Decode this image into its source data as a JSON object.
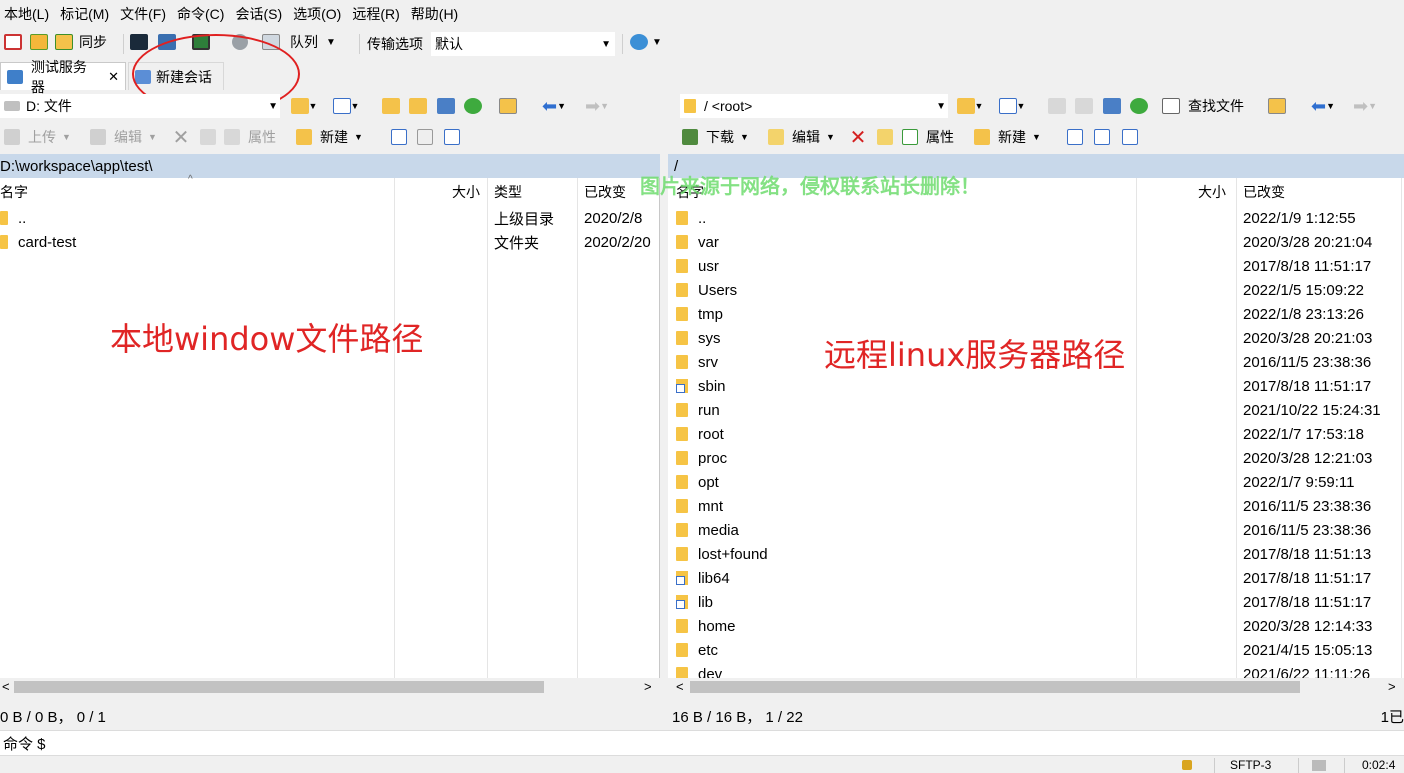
{
  "menu": [
    "本地(L)",
    "标记(M)",
    "文件(F)",
    "命令(C)",
    "会话(S)",
    "选项(O)",
    "远程(R)",
    "帮助(H)"
  ],
  "toolbar": {
    "sync_label": "同步",
    "queue_label": "队列",
    "transfer_options_label": "传输选项",
    "transfer_preset": "默认"
  },
  "tabs": {
    "active_label": "测试服务器",
    "close_glyph": "✕",
    "new_session_label": "新建会话"
  },
  "local": {
    "drive": "D: 文件",
    "upload_label": "上传",
    "edit_label": "编辑",
    "properties_label": "属性",
    "new_label": "新建",
    "path": "D:\\workspace\\app\\test\\",
    "columns": {
      "name": "名字",
      "size": "大小",
      "type": "类型",
      "modified": "已改变"
    },
    "rows": [
      {
        "name": "..",
        "size": "",
        "type": "上级目录",
        "modified": "2020/2/8"
      },
      {
        "name": "card-test",
        "size": "",
        "type": "文件夹",
        "modified": "2020/2/20"
      }
    ],
    "status": "0 B / 0 B， 0 / 1",
    "annotation": "本地window文件路径"
  },
  "remote": {
    "path_combo": "/ <root>",
    "find_files_label": "查找文件",
    "download_label": "下载",
    "edit_label": "编辑",
    "properties_label": "属性",
    "new_label": "新建",
    "path": "/",
    "columns": {
      "name": "名字",
      "size": "大小",
      "modified": "已改变"
    },
    "rows": [
      {
        "name": "..",
        "modified": "2022/1/9 1:12:55",
        "kind": "up"
      },
      {
        "name": "var",
        "modified": "2020/3/28 20:21:04",
        "kind": "folder"
      },
      {
        "name": "usr",
        "modified": "2017/8/18 11:51:17",
        "kind": "folder"
      },
      {
        "name": "Users",
        "modified": "2022/1/5 15:09:22",
        "kind": "folder"
      },
      {
        "name": "tmp",
        "modified": "2022/1/8 23:13:26",
        "kind": "folder"
      },
      {
        "name": "sys",
        "modified": "2020/3/28 20:21:03",
        "kind": "folder"
      },
      {
        "name": "srv",
        "modified": "2016/11/5 23:38:36",
        "kind": "folder"
      },
      {
        "name": "sbin",
        "modified": "2017/8/18 11:51:17",
        "kind": "link"
      },
      {
        "name": "run",
        "modified": "2021/10/22 15:24:31",
        "kind": "folder"
      },
      {
        "name": "root",
        "modified": "2022/1/7 17:53:18",
        "kind": "folder"
      },
      {
        "name": "proc",
        "modified": "2020/3/28 12:21:03",
        "kind": "folder"
      },
      {
        "name": "opt",
        "modified": "2022/1/7 9:59:11",
        "kind": "folder"
      },
      {
        "name": "mnt",
        "modified": "2016/11/5 23:38:36",
        "kind": "folder"
      },
      {
        "name": "media",
        "modified": "2016/11/5 23:38:36",
        "kind": "folder"
      },
      {
        "name": "lost+found",
        "modified": "2017/8/18 11:51:13",
        "kind": "folder"
      },
      {
        "name": "lib64",
        "modified": "2017/8/18 11:51:17",
        "kind": "link"
      },
      {
        "name": "lib",
        "modified": "2017/8/18 11:51:17",
        "kind": "link"
      },
      {
        "name": "home",
        "modified": "2020/3/28 12:14:33",
        "kind": "folder"
      },
      {
        "name": "etc",
        "modified": "2021/4/15 15:05:13",
        "kind": "folder"
      },
      {
        "name": "dev",
        "modified": "2021/6/22 11:11:26",
        "kind": "folder"
      }
    ],
    "status": "16 B / 16 B， 1 / 22",
    "status_right": "1已",
    "annotation": "远程linux服务器路径"
  },
  "watermark": "图片来源于网络，侵权联系站长删除！",
  "command": {
    "prompt": "命令 $"
  },
  "bottom": {
    "protocol": "SFTP-3",
    "time": "0:02:4"
  },
  "colors": {
    "annotation": "#e02525",
    "path_bar": "#c8d8ea",
    "folder": "#f6c445",
    "watermark": "#6fdc6f"
  }
}
